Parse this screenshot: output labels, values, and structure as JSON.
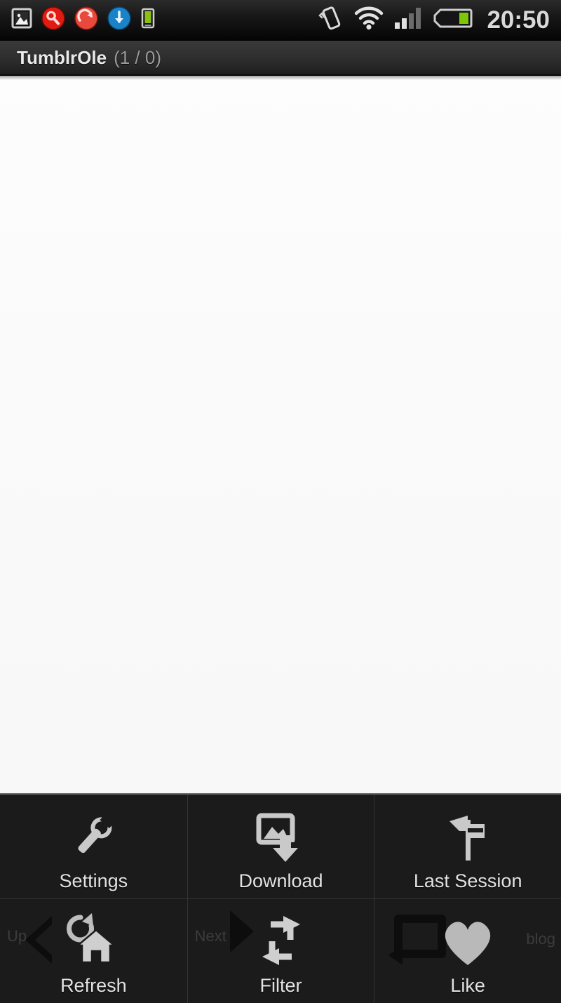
{
  "status_bar": {
    "time": "20:50",
    "left_icons": [
      {
        "name": "gallery-icon",
        "label": "Screenshot captured"
      },
      {
        "name": "search-icon",
        "label": "Search"
      },
      {
        "name": "sync-error-icon",
        "label": "Sync"
      },
      {
        "name": "download-circle-icon",
        "label": "Download complete"
      },
      {
        "name": "usb-charging-icon",
        "label": "USB connected"
      }
    ],
    "right_icons": [
      {
        "name": "vibrate-icon",
        "label": "Vibrate mode"
      },
      {
        "name": "wifi-icon",
        "label": "Wi-Fi connected"
      },
      {
        "name": "signal-icon",
        "label": "Mobile signal",
        "bars_lit": 2,
        "bars_total": 4
      },
      {
        "name": "battery-icon",
        "label": "Battery",
        "level_percent": 35
      }
    ],
    "colors": {
      "battery_fill": "#7cc70a",
      "usb_fill": "#8cc112",
      "search_red": "#e21b12",
      "sync_red": "#e8493c",
      "download_blue": "#1a82c8",
      "text": "#d9d9d9"
    }
  },
  "title_bar": {
    "app_name": "TumblrOle",
    "counter": "(1 / 0)"
  },
  "content": {
    "state": "blank",
    "background": "#fbfbfb"
  },
  "options_menu": {
    "rows": [
      {
        "cells": [
          {
            "label": "Settings",
            "icon": "wrench-icon"
          },
          {
            "label": "Download",
            "icon": "image-download-icon"
          },
          {
            "label": "Last Session",
            "icon": "flag-icon"
          }
        ]
      },
      {
        "cells": [
          {
            "label": "Refresh",
            "icon": "refresh-home-icon",
            "ghost_text": "Up"
          },
          {
            "label": "Filter",
            "icon": "reblog-arrows-icon",
            "ghost_text": "Next"
          },
          {
            "label": "Like",
            "icon": "heart-icon",
            "ghost_text": "blog"
          }
        ]
      }
    ],
    "colors": {
      "background": "#1b1b1b",
      "divider": "#343434",
      "top_border": "#6e6e6e",
      "icon": "#c9c9c9",
      "label": "#e2e2e2",
      "ghost": "#3c3c3c"
    }
  }
}
